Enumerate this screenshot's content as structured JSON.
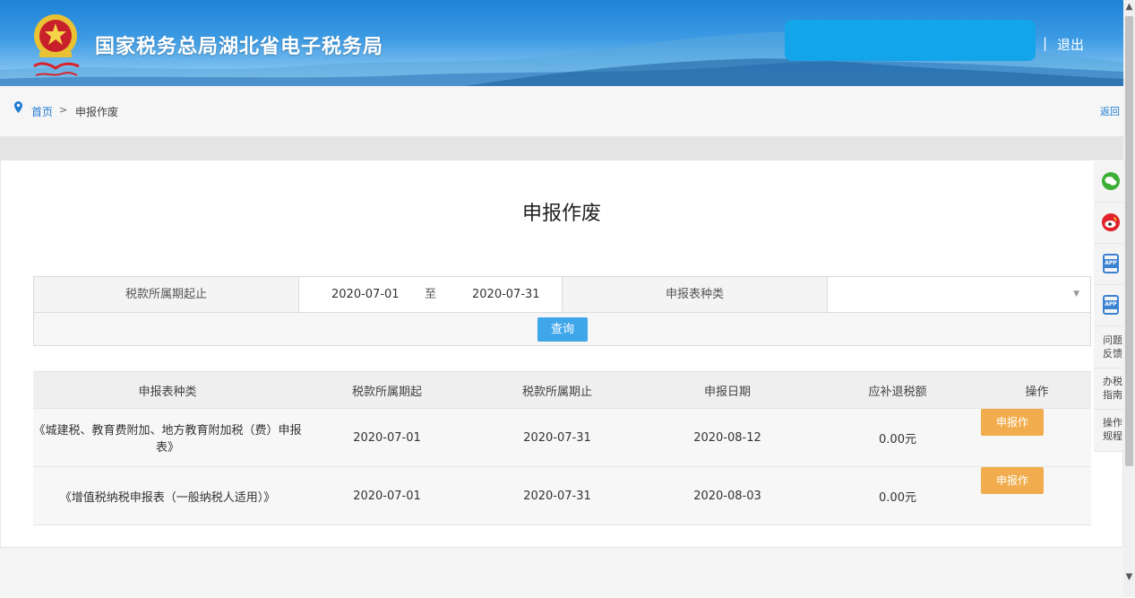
{
  "header": {
    "site_title": "国家税务总局湖北省电子税务局",
    "logout_separator": "|",
    "logout_label": "退出"
  },
  "breadcrumb": {
    "home": "首页",
    "separator": ">",
    "current": "申报作废",
    "back": "返回"
  },
  "page": {
    "title": "申报作废"
  },
  "search_form": {
    "period_label": "税款所属期起止",
    "date_from": "2020-07-01",
    "date_to_sep": "至",
    "date_to": "2020-07-31",
    "form_type_label": "申报表种类",
    "form_type_value": "",
    "query_label": "查询"
  },
  "table": {
    "headers": [
      "申报表种类",
      "税款所属期起",
      "税款所属期止",
      "申报日期",
      "应补退税额",
      "操作"
    ],
    "rows": [
      {
        "form": "《城建税、教育费附加、地方教育附加税（费）申报表》",
        "start": "2020-07-01",
        "end": "2020-07-31",
        "date": "2020-08-12",
        "amount": "0.00元",
        "action": "申报作"
      },
      {
        "form": "《增值税纳税申报表（一般纳税人适用）》",
        "start": "2020-07-01",
        "end": "2020-07-31",
        "date": "2020-08-03",
        "amount": "0.00元",
        "action": "申报作"
      }
    ]
  },
  "floatbar": {
    "feedback": "问题反馈",
    "guide": "办税指南",
    "rules": "操作规程",
    "app_label": "APP"
  },
  "colors": {
    "header_blue": "#1e82d6",
    "link_blue": "#1e7bd2",
    "query_button": "#3fa6ea",
    "void_button": "#f1ad4d",
    "wechat_green": "#3cb034",
    "weibo_red": "#e0212a"
  }
}
